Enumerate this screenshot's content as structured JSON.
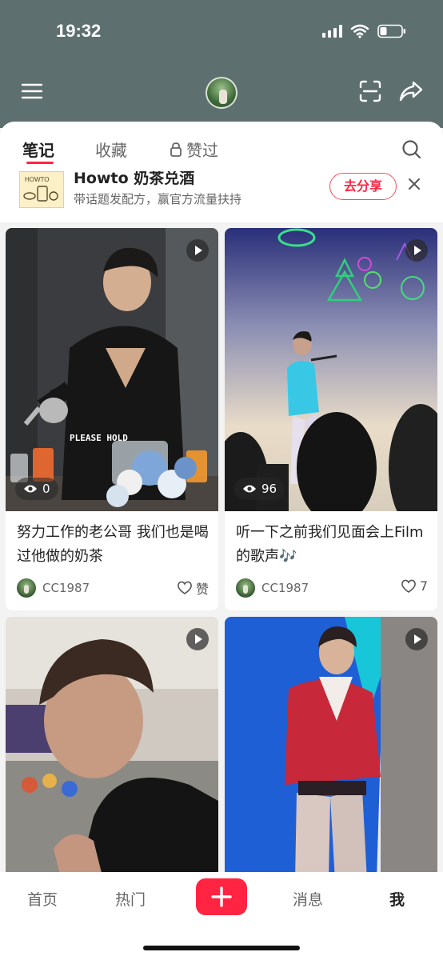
{
  "status_bar": {
    "time": "19:32"
  },
  "tabs": [
    {
      "label": "笔记",
      "active": true
    },
    {
      "label": "收藏",
      "active": false
    },
    {
      "label": "赞过",
      "active": false,
      "locked": true
    }
  ],
  "banner": {
    "title": "Howto 奶茶兑酒",
    "subtitle": "带话题发配方，赢官方流量扶持",
    "share_label": "去分享",
    "thumb_text": "HOWTO"
  },
  "notes": [
    {
      "title": "努力工作的老公哥 我们也是喝过他做的奶茶",
      "views": "0",
      "author": "CC1987",
      "likes": "赞",
      "overlay_text": "PLEASE HOLD"
    },
    {
      "title": "听一下之前我们见面会上Film的歌声🎶",
      "views": "96",
      "author": "CC1987",
      "likes": "7"
    },
    {
      "title": "",
      "views": "",
      "author": "",
      "likes": ""
    },
    {
      "title": "",
      "views": "",
      "author": "",
      "likes": ""
    }
  ],
  "bottom_nav": {
    "home": "首页",
    "hot": "热门",
    "messages": "消息",
    "me": "我"
  },
  "colors": {
    "accent": "#ff2442",
    "header_bg": "#5e6f6f"
  }
}
